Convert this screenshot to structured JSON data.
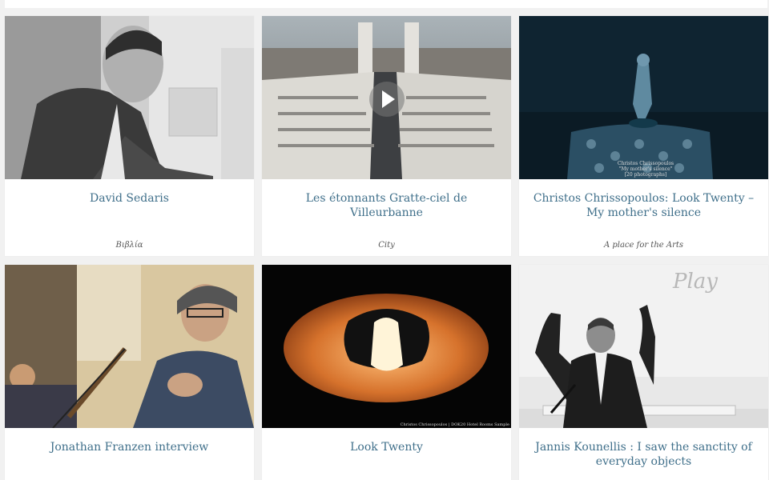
{
  "cards": [
    {
      "title": "David Sedaris",
      "category": "Βιβλία"
    },
    {
      "title": "Les étonnants Gratte-ciel de Villeurbanne",
      "category": "City"
    },
    {
      "title": "Christos Chrissopoulos: Look Twenty – My mother's silence",
      "category": "A place for the Arts"
    },
    {
      "title": "Jonathan Franzen interview",
      "category": ""
    },
    {
      "title": "Look Twenty",
      "category": ""
    },
    {
      "title": "Jannis Kounellis : I saw the sanctity of everyday objects",
      "category": ""
    }
  ],
  "overlays": {
    "card3_caption_line1": "Christos Chrissopoulos",
    "card3_caption_line2": "\"My mother's silence\"",
    "card3_caption_line3": "[20 photographs]",
    "card5_caption": "Christos Chrissopoulos | DOK20 Hotel Rooms Sample",
    "card6_sign": "Play"
  },
  "colors": {
    "background": "#f1f1f1",
    "card": "#ffffff",
    "title": "#3f6f8a",
    "category": "#555555"
  },
  "icons": {
    "video": "play-icon"
  }
}
